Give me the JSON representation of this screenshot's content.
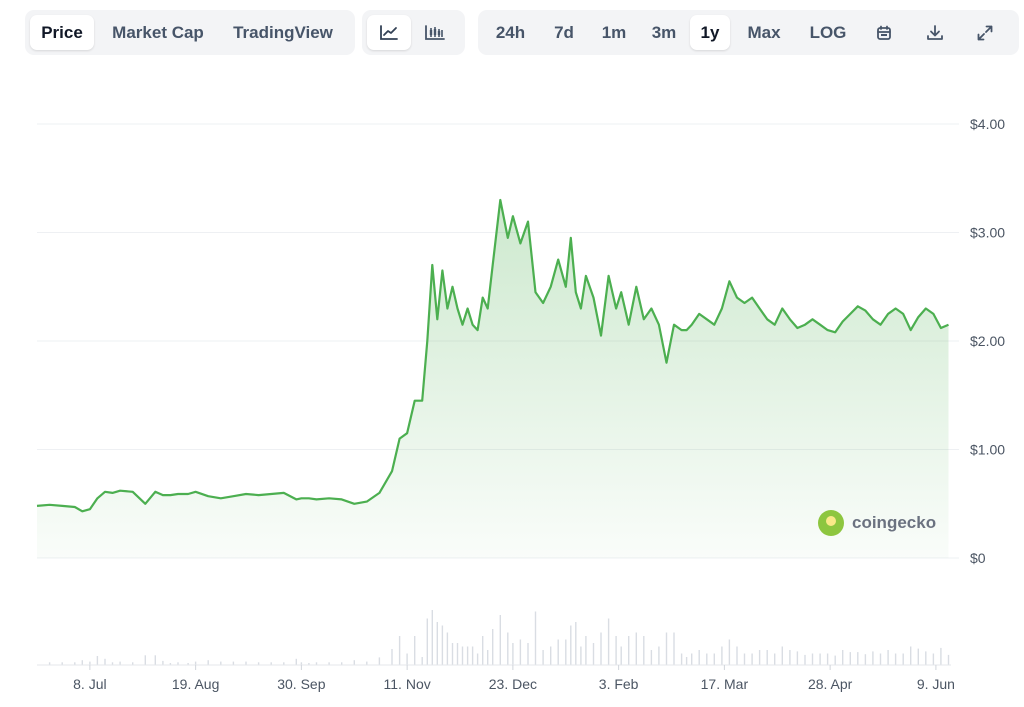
{
  "toolbar": {
    "views": [
      "Price",
      "Market Cap",
      "TradingView"
    ],
    "active_view": "Price",
    "chart_types": [
      {
        "icon": "line-chart-icon",
        "active": true
      },
      {
        "icon": "candlestick-chart-icon",
        "active": false
      }
    ],
    "ranges": [
      "24h",
      "7d",
      "1m",
      "3m",
      "1y",
      "Max",
      "LOG"
    ],
    "active_range": "1y",
    "actions": [
      {
        "icon": "calendar-icon"
      },
      {
        "icon": "download-icon"
      },
      {
        "icon": "fullscreen-icon"
      }
    ]
  },
  "watermark": "coingecko",
  "chart_data": {
    "type": "area",
    "title": "",
    "xlabel": "",
    "ylabel": "",
    "y_tick_labels": [
      "$4.00",
      "$3.00",
      "$2.00",
      "$1.00",
      "$0"
    ],
    "y_ticks": [
      4,
      3,
      2,
      1,
      0
    ],
    "ylim": [
      0,
      4
    ],
    "x_tick_labels": [
      "8. Jul",
      "19. Aug",
      "30. Sep",
      "11. Nov",
      "23. Dec",
      "3. Feb",
      "17. Mar",
      "28. Apr",
      "9. Jun"
    ],
    "x_ticks": [
      "2024-07-08",
      "2024-08-19",
      "2024-09-30",
      "2024-11-11",
      "2024-12-23",
      "2025-02-03",
      "2025-03-17",
      "2025-04-28",
      "2025-06-09"
    ],
    "xlim": [
      "2024-06-17",
      "2025-06-15"
    ],
    "grid": true,
    "line_color": "#4caf50",
    "series": [
      {
        "x": [
          "2024-06-17",
          "2024-06-22",
          "2024-06-27",
          "2024-07-02",
          "2024-07-05",
          "2024-07-08",
          "2024-07-11",
          "2024-07-14",
          "2024-07-17",
          "2024-07-20",
          "2024-07-25",
          "2024-07-30",
          "2024-08-03",
          "2024-08-06",
          "2024-08-09",
          "2024-08-12",
          "2024-08-16",
          "2024-08-19",
          "2024-08-24",
          "2024-08-29",
          "2024-09-03",
          "2024-09-08",
          "2024-09-13",
          "2024-09-18",
          "2024-09-23",
          "2024-09-28",
          "2024-09-30",
          "2024-10-03",
          "2024-10-06",
          "2024-10-11",
          "2024-10-16",
          "2024-10-21",
          "2024-10-26",
          "2024-10-31",
          "2024-11-05",
          "2024-11-08",
          "2024-11-11",
          "2024-11-14",
          "2024-11-17",
          "2024-11-19",
          "2024-11-21",
          "2024-11-23",
          "2024-11-25",
          "2024-11-27",
          "2024-11-29",
          "2024-12-01",
          "2024-12-03",
          "2024-12-05",
          "2024-12-07",
          "2024-12-09",
          "2024-12-11",
          "2024-12-13",
          "2024-12-15",
          "2024-12-18",
          "2024-12-21",
          "2024-12-23",
          "2024-12-26",
          "2024-12-29",
          "2025-01-01",
          "2025-01-04",
          "2025-01-07",
          "2025-01-10",
          "2025-01-13",
          "2025-01-15",
          "2025-01-17",
          "2025-01-19",
          "2025-01-21",
          "2025-01-24",
          "2025-01-27",
          "2025-01-30",
          "2025-02-02",
          "2025-02-04",
          "2025-02-07",
          "2025-02-10",
          "2025-02-13",
          "2025-02-16",
          "2025-02-19",
          "2025-02-22",
          "2025-02-25",
          "2025-02-28",
          "2025-03-02",
          "2025-03-04",
          "2025-03-07",
          "2025-03-10",
          "2025-03-13",
          "2025-03-16",
          "2025-03-19",
          "2025-03-22",
          "2025-03-25",
          "2025-03-28",
          "2025-03-31",
          "2025-04-03",
          "2025-04-06",
          "2025-04-09",
          "2025-04-12",
          "2025-04-15",
          "2025-04-18",
          "2025-04-21",
          "2025-04-24",
          "2025-04-27",
          "2025-04-30",
          "2025-05-03",
          "2025-05-06",
          "2025-05-09",
          "2025-05-12",
          "2025-05-15",
          "2025-05-18",
          "2025-05-21",
          "2025-05-24",
          "2025-05-27",
          "2025-05-30",
          "2025-06-02",
          "2025-06-05",
          "2025-06-08",
          "2025-06-11",
          "2025-06-14"
        ],
        "y": [
          0.48,
          0.49,
          0.48,
          0.47,
          0.43,
          0.45,
          0.55,
          0.61,
          0.6,
          0.62,
          0.61,
          0.5,
          0.61,
          0.58,
          0.58,
          0.59,
          0.59,
          0.61,
          0.57,
          0.55,
          0.57,
          0.59,
          0.58,
          0.59,
          0.6,
          0.54,
          0.55,
          0.55,
          0.54,
          0.55,
          0.54,
          0.5,
          0.52,
          0.6,
          0.8,
          1.1,
          1.15,
          1.45,
          1.45,
          2.0,
          2.7,
          2.2,
          2.65,
          2.3,
          2.5,
          2.3,
          2.15,
          2.3,
          2.15,
          2.1,
          2.4,
          2.3,
          2.7,
          3.3,
          2.95,
          3.15,
          2.9,
          3.1,
          2.45,
          2.35,
          2.5,
          2.75,
          2.5,
          2.95,
          2.45,
          2.3,
          2.6,
          2.4,
          2.05,
          2.6,
          2.3,
          2.45,
          2.15,
          2.5,
          2.2,
          2.3,
          2.15,
          1.8,
          2.15,
          2.1,
          2.1,
          2.15,
          2.25,
          2.2,
          2.15,
          2.3,
          2.55,
          2.4,
          2.35,
          2.4,
          2.3,
          2.2,
          2.15,
          2.3,
          2.2,
          2.12,
          2.15,
          2.2,
          2.15,
          2.1,
          2.08,
          2.18,
          2.25,
          2.32,
          2.28,
          2.2,
          2.15,
          2.25,
          2.3,
          2.25,
          2.1,
          2.22,
          2.3,
          2.25,
          2.12,
          2.15
        ]
      }
    ],
    "volume_note": "volume bars shown without axis"
  }
}
